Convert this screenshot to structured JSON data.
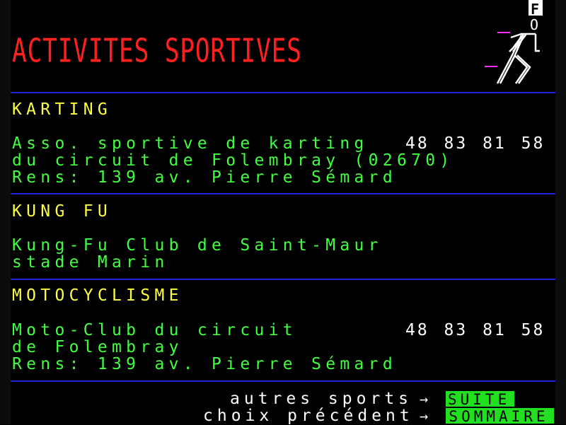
{
  "header": {
    "title": "ACTIVITES SPORTIVES",
    "logo_letter_top": "F",
    "logo_letter_bottom": "O"
  },
  "sections": [
    {
      "heading": "KARTING",
      "lines": [
        "Asso. sportive de karting",
        "du circuit de Folembray (02670)",
        "Rens: 139 av. Pierre Sémard"
      ],
      "phone": "48 83 81 58"
    },
    {
      "heading": "KUNG FU",
      "lines": [
        "Kung-Fu Club de Saint-Maur",
        "stade Marin"
      ]
    },
    {
      "heading": "MOTOCYCLISME",
      "lines": [
        "Moto-Club du circuit",
        "de Folembray",
        "Rens: 139 av. Pierre Sémard"
      ],
      "phone": "48 83 81 58"
    }
  ],
  "footer": {
    "next_label": "autres sports",
    "next_key": "SUITE",
    "prev_label": "choix précédent",
    "prev_key": "SOMMAIRE",
    "arrow": "→"
  },
  "colors": {
    "background": "#000000",
    "title": "#ff2020",
    "heading": "#ffff40",
    "body_text": "#40ff40",
    "phone": "#ffffff",
    "separator": "#2020d8",
    "key_background": "#20e020"
  }
}
